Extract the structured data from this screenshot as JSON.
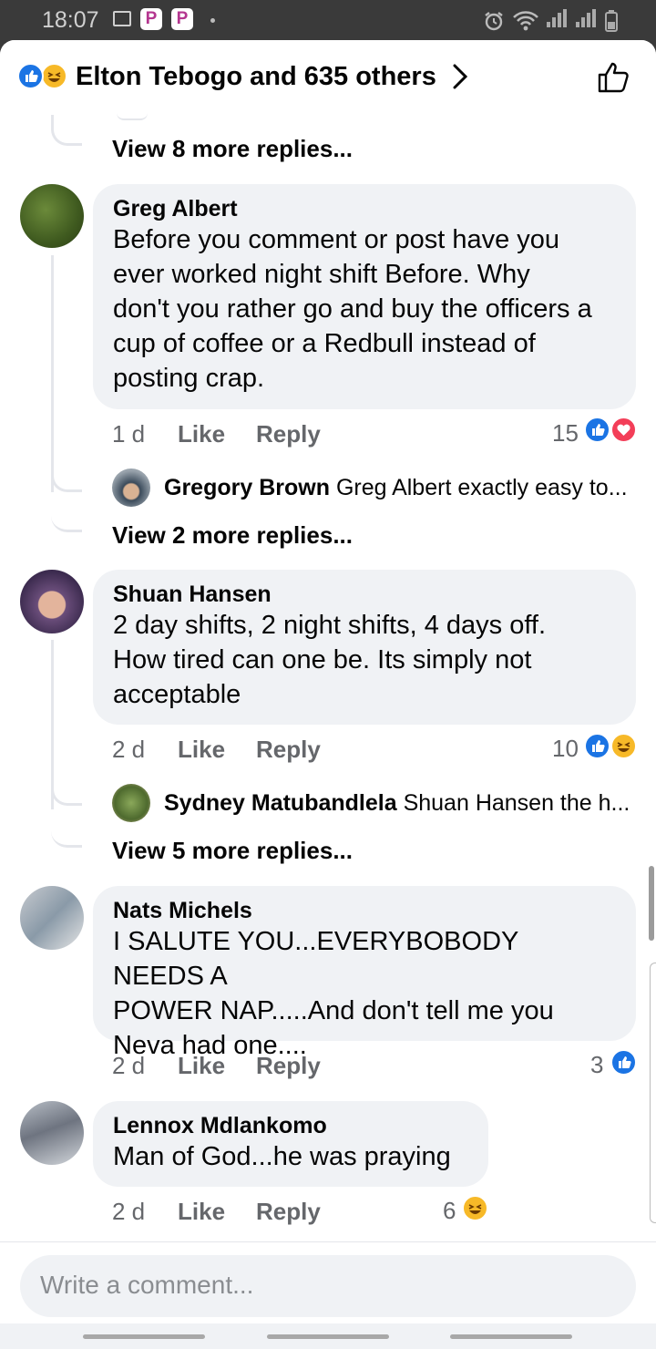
{
  "status_bar": {
    "time": "18:07"
  },
  "header": {
    "title": "Elton Tebogo and 635 others",
    "reaction_icons": [
      "like-icon",
      "haha-icon"
    ]
  },
  "top_thread": {
    "more_replies": "View 8 more replies..."
  },
  "comments": [
    {
      "author": "Greg Albert",
      "lines": [
        "Before you comment or post have you",
        "ever worked night shift Before.  Why",
        "don't you rather go and buy the officers a",
        "cup of coffee or a Redbull instead of",
        "posting crap."
      ],
      "time": "1 d",
      "like": "Like",
      "reply": "Reply",
      "reaction_count": "15",
      "reactions": [
        "like",
        "love"
      ],
      "reply_preview": {
        "author": "Gregory Brown",
        "text": "Greg Albert exactly easy to..."
      },
      "more_replies": "View 2 more replies..."
    },
    {
      "author": "Shuan Hansen",
      "lines": [
        "2 day shifts, 2 night shifts, 4 days off.",
        "How tired can one be. Its simply not",
        "acceptable"
      ],
      "time": "2 d",
      "like": "Like",
      "reply": "Reply",
      "reaction_count": "10",
      "reactions": [
        "like",
        "haha"
      ],
      "reply_preview": {
        "author": "Sydney Matubandlela",
        "text": "Shuan Hansen the h..."
      },
      "more_replies": "View 5 more replies..."
    },
    {
      "author": "Nats Michels",
      "lines": [
        "I SALUTE YOU...EVERYBOBODY NEEDS A",
        "POWER NAP.....And don't tell me you",
        "Neva had one...."
      ],
      "time": "2 d",
      "like": "Like",
      "reply": "Reply",
      "reaction_count": "3",
      "reactions": [
        "like"
      ]
    },
    {
      "author": "Lennox Mdlankomo",
      "lines": [
        "Man of God...he was praying"
      ],
      "time": "2 d",
      "like": "Like",
      "reply": "Reply",
      "reaction_count": "6",
      "reactions": [
        "haha"
      ]
    }
  ],
  "composer": {
    "placeholder": "Write a comment..."
  }
}
